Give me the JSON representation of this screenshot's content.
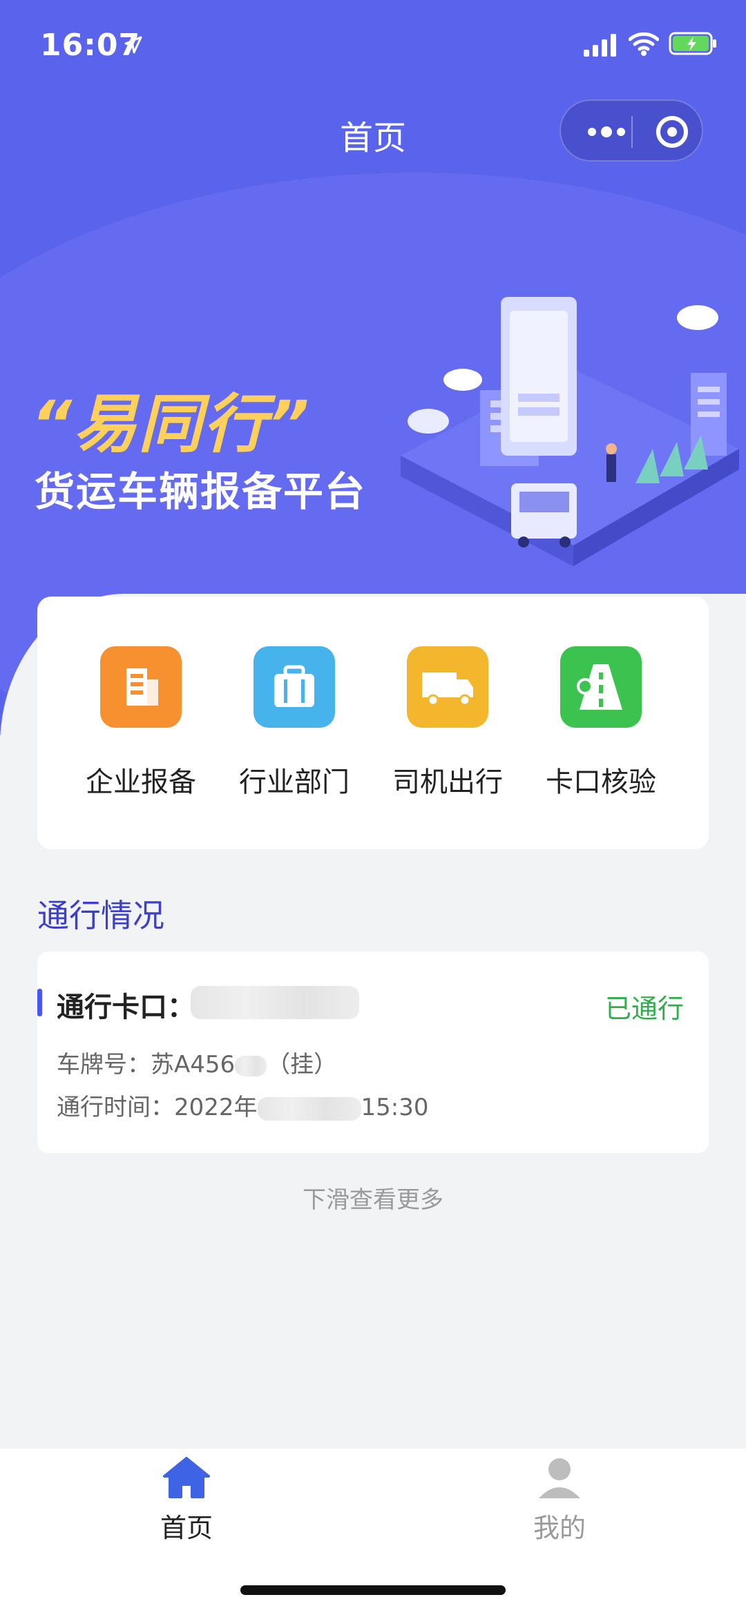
{
  "status_bar": {
    "time": "16:07"
  },
  "nav": {
    "title": "首页"
  },
  "banner": {
    "title": "“易同行”",
    "subtitle": "货运车辆报备平台"
  },
  "menu": {
    "items": [
      {
        "label": "企业报备",
        "icon": "building-icon",
        "color": "#f7902f"
      },
      {
        "label": "行业部门",
        "icon": "briefcase-icon",
        "color": "#46b3ec"
      },
      {
        "label": "司机出行",
        "icon": "truck-icon",
        "color": "#f3b62d"
      },
      {
        "label": "卡口核验",
        "icon": "road-checkpoint-icon",
        "color": "#3cc34f"
      }
    ]
  },
  "section": {
    "title": "通行情况"
  },
  "record": {
    "checkpoint_label": "通行卡口：",
    "status": "已通行",
    "plate_label": "车牌号：",
    "plate_value": "苏A456",
    "plate_suffix": "（挂）",
    "time_label": "通行时间：",
    "time_value_start": "2022年",
    "time_value_end": "15:30"
  },
  "more_hint": "下滑查看更多",
  "tabbar": {
    "tabs": [
      {
        "label": "首页",
        "icon": "home-icon",
        "active": true,
        "color": "#3e63e5"
      },
      {
        "label": "我的",
        "icon": "user-icon",
        "active": false,
        "color": "#bdbdbd"
      }
    ]
  },
  "colors": {
    "primary": "#5a63ec",
    "success": "#2fae4b",
    "section_title": "#3b3fcb"
  }
}
